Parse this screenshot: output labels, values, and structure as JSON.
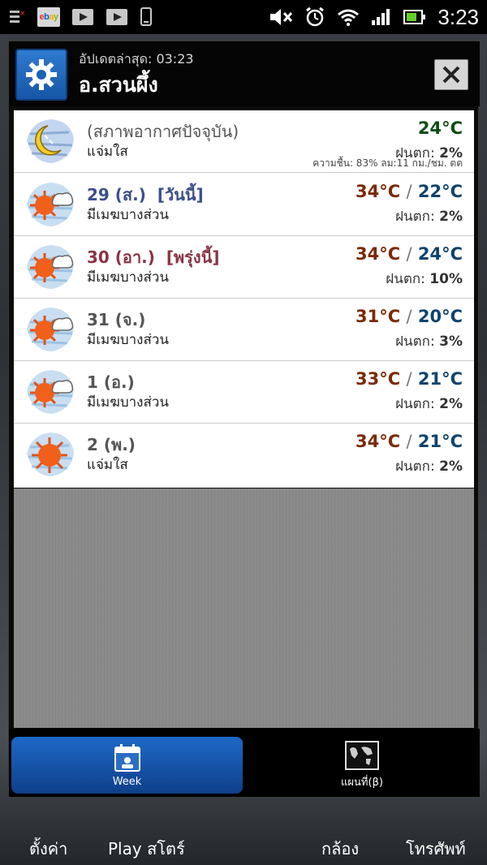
{
  "status_bar": {
    "time": "3:23",
    "left_icons": [
      "bars-notification-icon",
      "ebay-icon",
      "youtube-icon",
      "youtube-icon",
      "phone-icon"
    ],
    "right_icons": [
      "mute-icon",
      "alarm-icon",
      "wifi-icon",
      "signal-icon",
      "battery-icon"
    ],
    "ebay_text": "ebay"
  },
  "header": {
    "updated": "อัปเดตล่าสุด: 03:23",
    "location": "อ.สวนผึ้ง"
  },
  "current": {
    "day": "(สภาพอากาศปัจจุบัน)",
    "condition": "แจ่มใส",
    "temp": "24°C",
    "rain_label": "ฝนตก:",
    "rain_value": "2%",
    "extra": "ความชื้น: 83% ลม:11 กม./ชม. ตต"
  },
  "forecast": [
    {
      "day": "29 (ส.)",
      "tag": "[วันนี้]",
      "condition": "มีเมฆบางส่วน",
      "high": "34°C",
      "low": "22°C",
      "rain_label": "ฝนตก:",
      "rain_value": "2%",
      "day_color": "#3b4f8a"
    },
    {
      "day": "30 (อา.)",
      "tag": "[พรุ่งนี้]",
      "condition": "มีเมฆบางส่วน",
      "high": "34°C",
      "low": "24°C",
      "rain_label": "ฝนตก:",
      "rain_value": "10%",
      "day_color": "#8a3445"
    },
    {
      "day": "31 (จ.)",
      "tag": "",
      "condition": "มีเมฆบางส่วน",
      "high": "31°C",
      "low": "20°C",
      "rain_label": "ฝนตก:",
      "rain_value": "3%",
      "day_color": "#555555"
    },
    {
      "day": "1 (อ.)",
      "tag": "",
      "condition": "มีเมฆบางส่วน",
      "high": "33°C",
      "low": "21°C",
      "rain_label": "ฝนตก:",
      "rain_value": "2%",
      "day_color": "#555555"
    },
    {
      "day": "2 (พ.)",
      "tag": "",
      "condition": "แจ่มใส",
      "high": "34°C",
      "low": "21°C",
      "rain_label": "ฝนตก:",
      "rain_value": "2%",
      "day_color": "#555555"
    }
  ],
  "temp_separator": "/",
  "bottom_nav": {
    "week_label": "Week",
    "map_label": "แผนที่(β)"
  },
  "dock": {
    "settings": "ตั้งค่า",
    "play_store": "Play สโตร์",
    "camera": "กล้อง",
    "phone": "โทรศัพท์"
  },
  "colors": {
    "accent_blue": "#1d69c6",
    "temp_high": "#7a2a06",
    "temp_low": "#10436e",
    "temp_current": "#0f4d16"
  }
}
